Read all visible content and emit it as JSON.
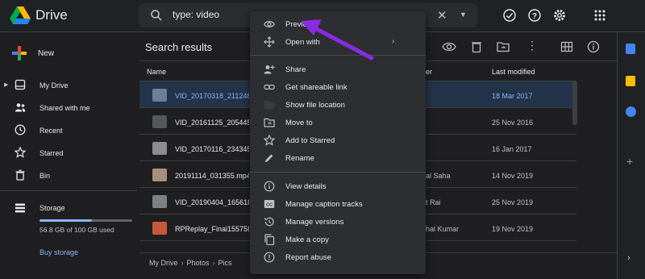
{
  "app": {
    "title": "Drive"
  },
  "search": {
    "query": "type: video"
  },
  "sidebar": {
    "new_label": "New",
    "items": [
      {
        "label": "My Drive",
        "icon": "my-drive-icon"
      },
      {
        "label": "Shared with me",
        "icon": "people-icon"
      },
      {
        "label": "Recent",
        "icon": "clock-icon"
      },
      {
        "label": "Starred",
        "icon": "star-icon"
      },
      {
        "label": "Bin",
        "icon": "bin-icon"
      }
    ],
    "storage": {
      "label": "Storage",
      "usage": "56.8 GB of 100 GB used",
      "used_fraction": 0.568,
      "buy_label": "Buy storage"
    }
  },
  "main": {
    "title": "Search results",
    "columns": {
      "name": "Name",
      "owner": "er",
      "modified": "Last modified"
    },
    "rows": [
      {
        "name": "VID_20170318_211248",
        "owner": "",
        "modified": "18 Mar 2017",
        "selected": true
      },
      {
        "name": "VID_20161125_205445",
        "owner": "",
        "modified": "25 Nov 2016",
        "selected": false
      },
      {
        "name": "VID_20170116_234345",
        "owner": "",
        "modified": "16 Jan 2017",
        "selected": false
      },
      {
        "name": "20191114_031355.mp4",
        "owner": "al Saha",
        "modified": "14 Nov 2019",
        "selected": false
      },
      {
        "name": "VID_20190404_165618",
        "owner": "t Rai",
        "modified": "25 Nov 2019",
        "selected": false
      },
      {
        "name": "RPReplay_Final155758",
        "owner": "hal Kumar",
        "modified": "19 Nov 2019",
        "selected": false
      }
    ],
    "breadcrumb": [
      "My Drive",
      "Photos",
      "Pics"
    ]
  },
  "context_menu": {
    "groups": [
      [
        {
          "label": "Preview",
          "icon": "eye-icon"
        },
        {
          "label": "Open with",
          "icon": "move-arrows-icon",
          "submenu": true
        }
      ],
      [
        {
          "label": "Share",
          "icon": "person-add-icon"
        },
        {
          "label": "Get shareable link",
          "icon": "link-icon"
        },
        {
          "label": "Show file location",
          "icon": "folder-icon"
        },
        {
          "label": "Move to",
          "icon": "move-folder-icon"
        },
        {
          "label": "Add to Starred",
          "icon": "star-icon"
        },
        {
          "label": "Rename",
          "icon": "pencil-icon"
        }
      ],
      [
        {
          "label": "View details",
          "icon": "info-icon"
        },
        {
          "label": "Manage caption tracks",
          "icon": "captions-icon"
        },
        {
          "label": "Manage versions",
          "icon": "history-icon"
        },
        {
          "label": "Make a copy",
          "icon": "copy-icon"
        },
        {
          "label": "Report abuse",
          "icon": "alert-icon"
        }
      ]
    ]
  },
  "colors": {
    "background": "#1f1f21",
    "accent": "#8ab4f8",
    "selected_row": "#233349",
    "menu": "#2d2e31",
    "annotation_arrow": "#8a2be2"
  }
}
